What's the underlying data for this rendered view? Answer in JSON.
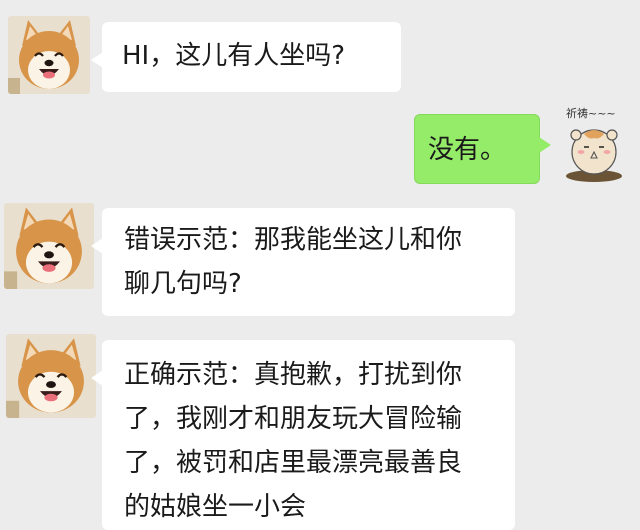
{
  "conversation": {
    "messages": [
      {
        "sender": "shiba",
        "avatar": "shiba-dog-avatar",
        "lines": [
          "HI，这儿有人坐吗?"
        ]
      },
      {
        "sender": "hamster",
        "avatar": "hamster-praying-avatar",
        "avatar_caption": "祈祷~~~",
        "lines": [
          "没有。"
        ]
      },
      {
        "sender": "shiba",
        "avatar": "shiba-dog-avatar",
        "lines": [
          "错误示范：那我能坐这儿和你",
          "聊几句吗?"
        ]
      },
      {
        "sender": "shiba",
        "avatar": "shiba-dog-avatar",
        "lines": [
          "正确示范：真抱歉，打扰到你",
          "了，我刚才和朋友玩大冒险输",
          "了，被罚和店里最漂亮最善良",
          "的姑娘坐一小会"
        ]
      }
    ]
  },
  "colors": {
    "background": "#ececec",
    "incoming_bubble": "#ffffff",
    "outgoing_bubble": "#95ec69"
  }
}
